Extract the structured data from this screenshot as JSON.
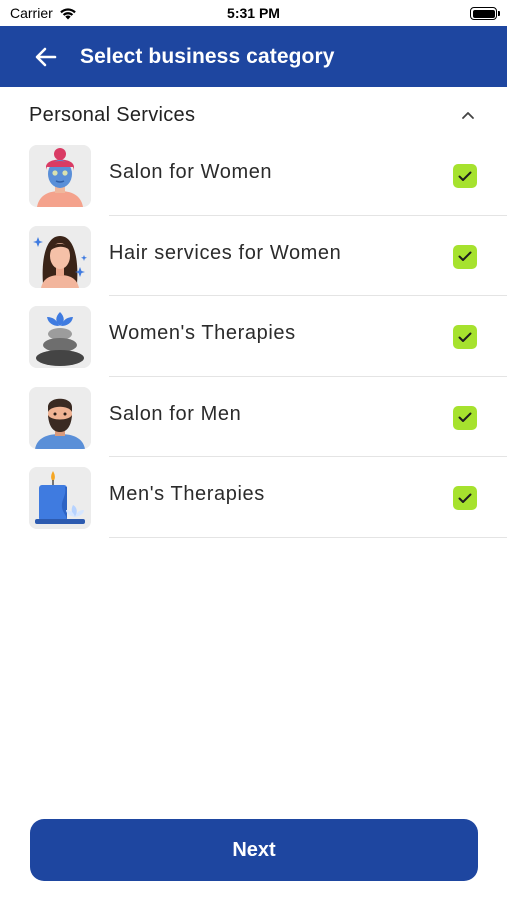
{
  "status_bar": {
    "carrier": "Carrier",
    "time": "5:31 PM"
  },
  "header": {
    "title": "Select business category",
    "back_icon": "arrow-left-icon"
  },
  "section": {
    "title": "Personal Services",
    "expanded": true,
    "toggle_icon": "chevron-up-icon"
  },
  "items": [
    {
      "label": "Salon for Women",
      "icon": "woman-face-mask-icon",
      "checked": true
    },
    {
      "label": "Hair services for Women",
      "icon": "woman-long-hair-icon",
      "checked": true
    },
    {
      "label": "Women's Therapies",
      "icon": "spa-stones-icon",
      "checked": true
    },
    {
      "label": "Salon for Men",
      "icon": "bearded-man-icon",
      "checked": true
    },
    {
      "label": "Men's Therapies",
      "icon": "candle-lotus-icon",
      "checked": true
    }
  ],
  "footer": {
    "next_label": "Next"
  },
  "colors": {
    "primary": "#1e46a0",
    "check": "#a6e22e",
    "divider": "#e4e4e4"
  }
}
